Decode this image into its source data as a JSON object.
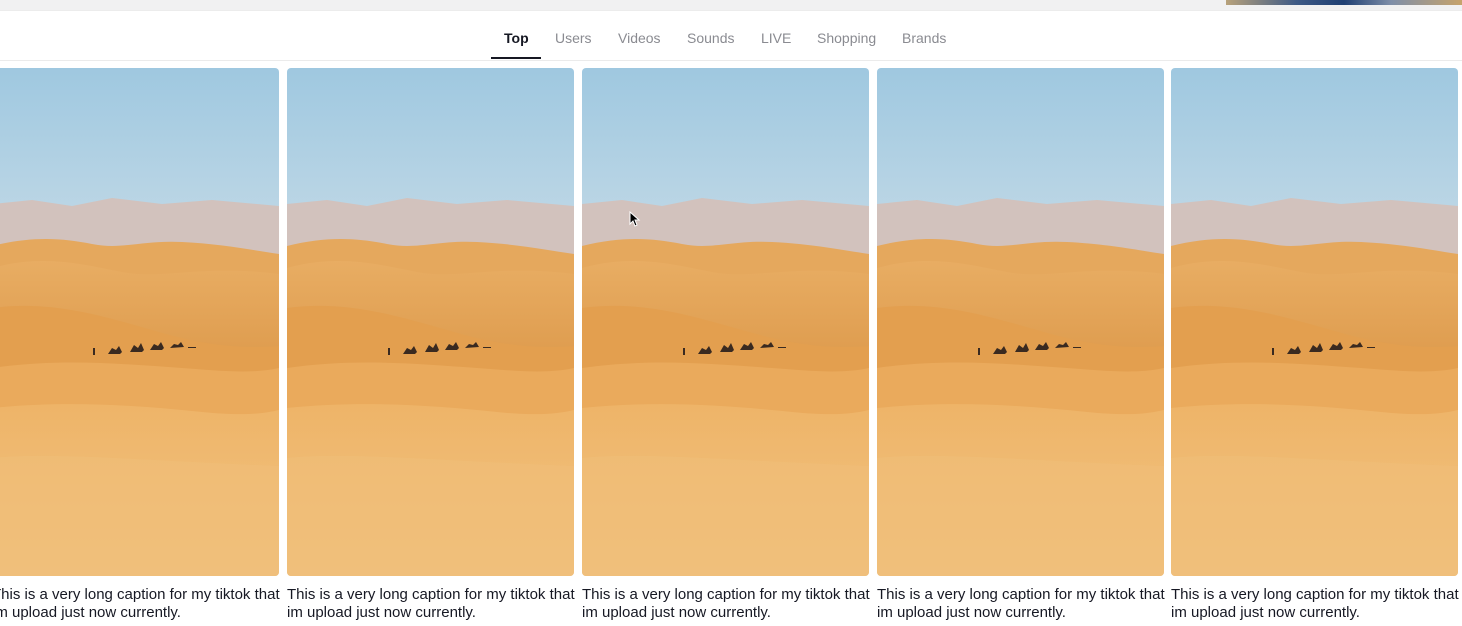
{
  "tabs": [
    {
      "label": "Top",
      "active": true
    },
    {
      "label": "Users",
      "active": false
    },
    {
      "label": "Videos",
      "active": false
    },
    {
      "label": "Sounds",
      "active": false
    },
    {
      "label": "LIVE",
      "active": false
    },
    {
      "label": "Shopping",
      "active": false
    },
    {
      "label": "Brands",
      "active": false
    }
  ],
  "videos": [
    {
      "caption": "This is a very long caption for my tiktok that im upload just now currently."
    },
    {
      "caption": "This is a very long caption for my tiktok that im upload just now currently."
    },
    {
      "caption": "This is a very long caption for my tiktok that im upload just now currently."
    },
    {
      "caption": "This is a very long caption for my tiktok that im upload just now currently."
    },
    {
      "caption": "This is a very long caption for my tiktok that im upload just now currently."
    }
  ],
  "colors": {
    "active_tab": "#161823",
    "inactive_tab": "#8a8b91",
    "sky": "#a9cde3",
    "sand": "#e9a95a"
  }
}
